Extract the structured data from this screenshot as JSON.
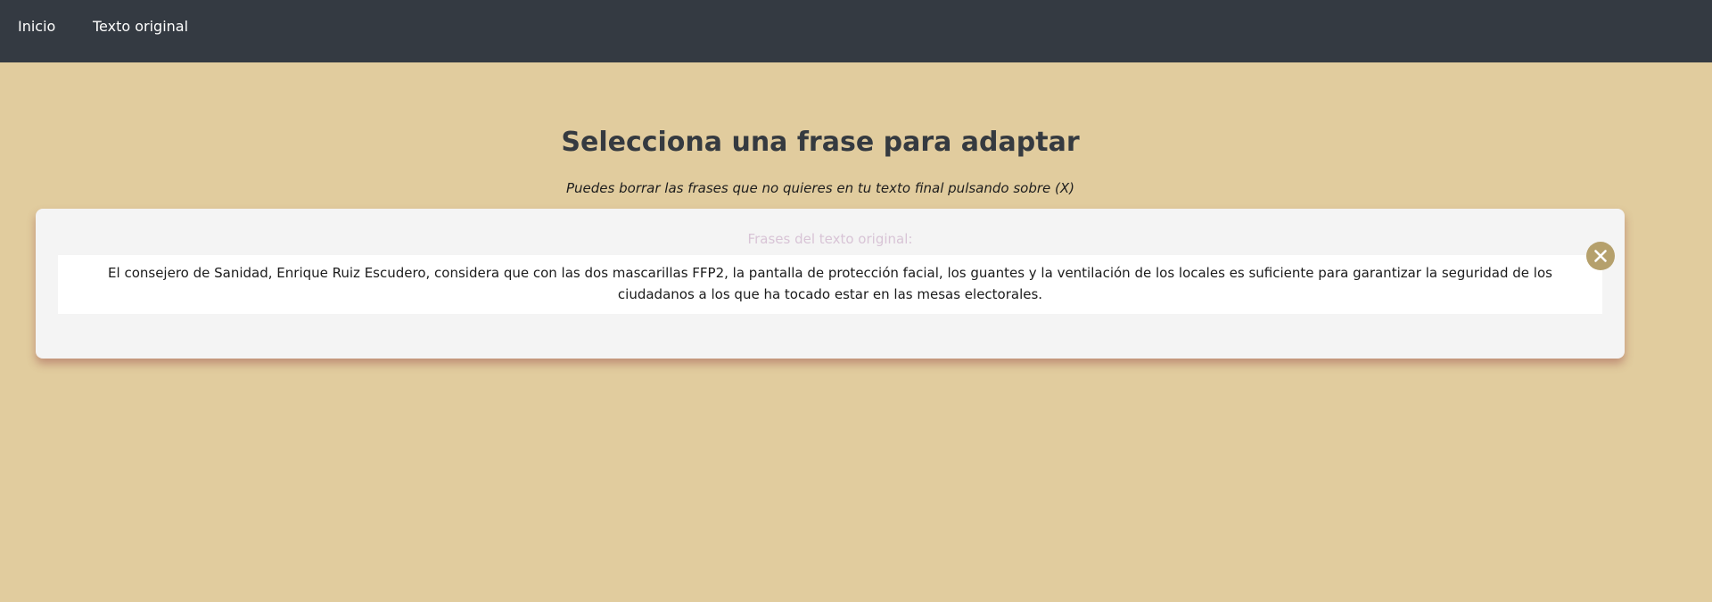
{
  "nav": {
    "items": [
      {
        "label": "Inicio"
      },
      {
        "label": "Texto original"
      }
    ]
  },
  "header": {
    "title": "Selecciona una frase para adaptar",
    "subtitle": "Puedes borrar las frases que no quieres en tu texto final pulsando sobre (X)"
  },
  "card": {
    "label": "Frases del texto original:",
    "sentences": [
      {
        "text": "El consejero de Sanidad, Enrique Ruiz Escudero, considera que con las dos mascarillas FFP2, la pantalla de protección facial, los guantes y la ventilación de los locales es suficiente para garantizar la seguridad de los ciudadanos a los que ha tocado estar en las mesas electorales."
      }
    ]
  },
  "icons": {
    "close": "close-icon"
  },
  "colors": {
    "background": "#e1cc9e",
    "navbar": "#343a42",
    "card": "#f4f4f4",
    "close_button": "#b5a06c",
    "card_label": "#d8c4d6"
  }
}
